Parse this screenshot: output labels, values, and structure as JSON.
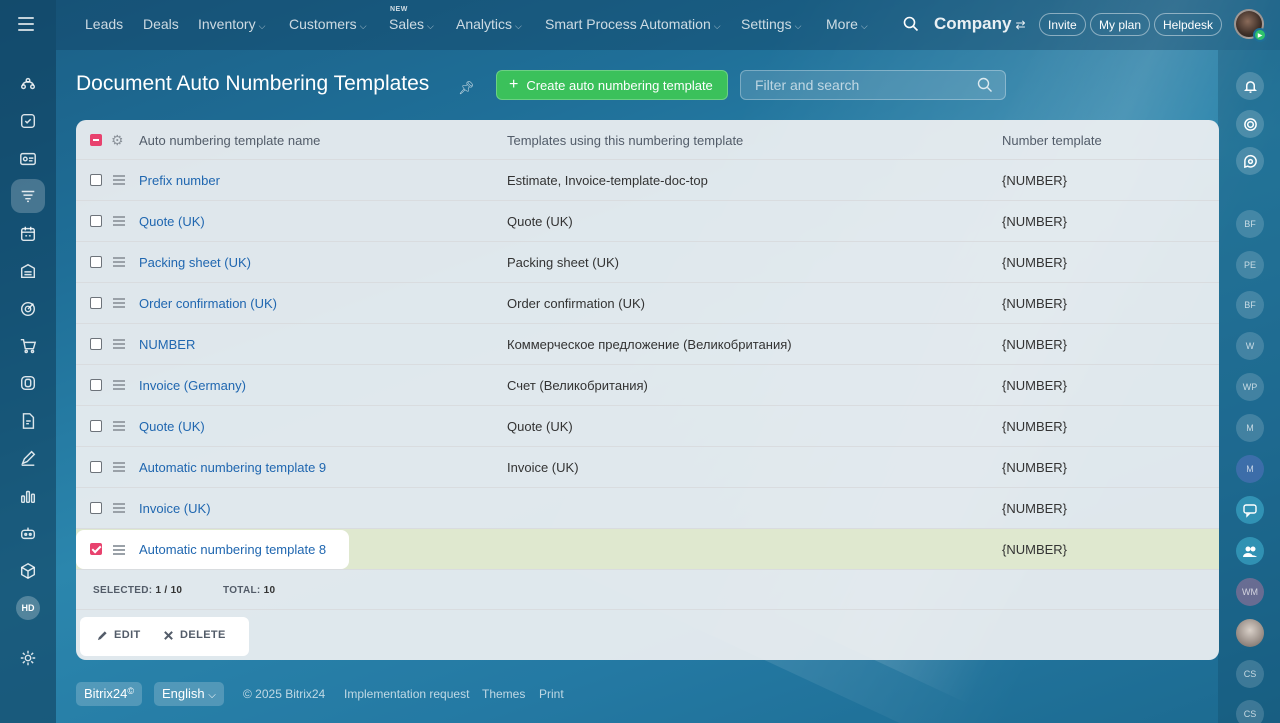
{
  "nav": {
    "items": [
      {
        "label": "Leads",
        "dropdown": false
      },
      {
        "label": "Deals",
        "dropdown": false
      },
      {
        "label": "Inventory",
        "dropdown": true
      },
      {
        "label": "Customers",
        "dropdown": true
      },
      {
        "label": "Sales",
        "dropdown": true,
        "badge": "NEW"
      },
      {
        "label": "Analytics",
        "dropdown": true
      },
      {
        "label": "Smart Process Automation",
        "dropdown": true
      },
      {
        "label": "Settings",
        "dropdown": true
      },
      {
        "label": "More",
        "dropdown": true
      }
    ],
    "company": "Company",
    "invite": "Invite",
    "my_plan": "My plan",
    "helpdesk": "Helpdesk"
  },
  "page": {
    "title": "Document Auto Numbering Templates",
    "create_button": "Create auto numbering template",
    "search_placeholder": "Filter and search"
  },
  "table": {
    "headers": [
      "Auto numbering template name",
      "Templates using this numbering template",
      "Number template"
    ],
    "rows": [
      {
        "name": "Prefix number",
        "templates": "Estimate, Invoice-template-doc-top",
        "number": "{NUMBER}",
        "checked": false
      },
      {
        "name": "Quote (UK)",
        "templates": "Quote (UK)",
        "number": "{NUMBER}",
        "checked": false
      },
      {
        "name": "Packing sheet (UK)",
        "templates": "Packing sheet (UK)",
        "number": "{NUMBER}",
        "checked": false
      },
      {
        "name": "Order confirmation (UK)",
        "templates": "Order confirmation (UK)",
        "number": "{NUMBER}",
        "checked": false
      },
      {
        "name": "NUMBER",
        "templates": "Коммерческое предложение (Великобритания)",
        "number": "{NUMBER}",
        "checked": false
      },
      {
        "name": "Invoice (Germany)",
        "templates": "Счет (Великобритания)",
        "number": "{NUMBER}",
        "checked": false
      },
      {
        "name": "Quote (UK)",
        "templates": "Quote (UK)",
        "number": "{NUMBER}",
        "checked": false
      },
      {
        "name": "Automatic numbering template 9",
        "templates": "Invoice (UK)",
        "number": "{NUMBER}",
        "checked": false
      },
      {
        "name": "Invoice (UK)",
        "templates": "",
        "number": "{NUMBER}",
        "checked": false
      },
      {
        "name": "Automatic numbering template 8",
        "templates": "",
        "number": "{NUMBER}",
        "checked": true
      }
    ],
    "selected_label": "SELECTED:",
    "selected_value": "1 / 10",
    "total_label": "TOTAL:",
    "total_value": "10"
  },
  "actions": {
    "edit": "EDIT",
    "delete": "DELETE"
  },
  "footer": {
    "brand": "Bitrix24",
    "brand_mark": "©",
    "language": "English",
    "copyright": "© 2025 Bitrix24",
    "implementation": "Implementation request",
    "themes": "Themes",
    "print": "Print"
  },
  "sidebar": {
    "hd_label": "HD"
  },
  "right_panel": {
    "avatars": [
      "BF",
      "PE",
      "BF",
      "W",
      "WP",
      "M",
      "M",
      "WM",
      "CS",
      "CS"
    ]
  },
  "colors": {
    "accent_green": "#3bc15b",
    "checkbox_pink": "#e8426e",
    "link_blue": "#2067b0",
    "selected_row": "#dfe8cf"
  }
}
